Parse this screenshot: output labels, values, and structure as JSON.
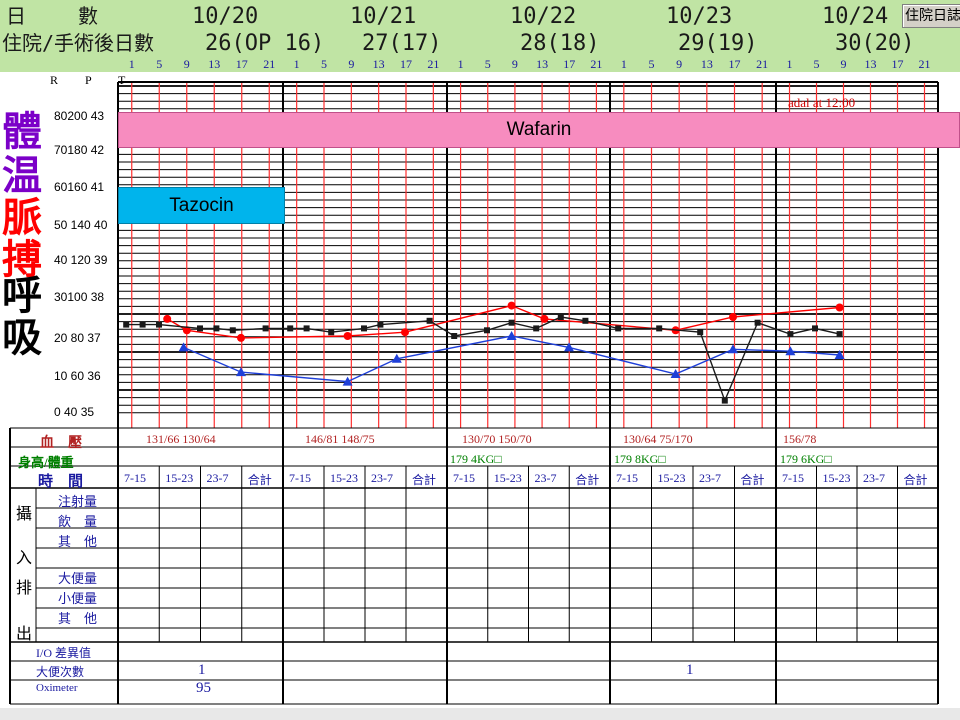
{
  "header": {
    "row1_label": "日　　 數",
    "dates": [
      "10/20",
      "10/21",
      "10/22",
      "10/23",
      "10/24"
    ],
    "row2_label": "住院/手術後日數",
    "postop_days": [
      "26(OP 16)",
      "27(17)",
      "28(18)",
      "29(19)",
      "30(20)"
    ],
    "hours": [
      "1",
      "5",
      "9",
      "13",
      "17",
      "21"
    ],
    "button_label": "住院日誌"
  },
  "chart": {
    "axis_header": "R P T",
    "y_labels": [
      "80200 43",
      "70180 42",
      "60160 41",
      "50 140 40",
      "40 120 39",
      "30100 38",
      "20 80 37",
      "10 60 36",
      "0 40 35"
    ],
    "side_chars": [
      "體",
      "温",
      "脈",
      "搏",
      "呼",
      "吸"
    ],
    "side_colors": [
      "#7b00c8",
      "#7b00c8",
      "#ff0000",
      "#ff0000",
      "#000000",
      "#000000"
    ],
    "partial_note": "adal at 12:00",
    "banners": {
      "wafarin": "Wafarin",
      "tazocin": "Tazocin"
    }
  },
  "chart_data": {
    "type": "line",
    "x_days": [
      "10/20",
      "10/21",
      "10/22",
      "10/23",
      "10/24"
    ],
    "series": [
      {
        "color": "#ff0000",
        "marker": "circle",
        "points": [
          [
            0.3,
            24.5
          ],
          [
            0.42,
            21.5
          ],
          [
            0.75,
            19.5
          ],
          [
            1.4,
            20
          ],
          [
            1.75,
            21
          ],
          [
            2.4,
            28
          ],
          [
            2.6,
            24.5
          ],
          [
            3.4,
            21.5
          ],
          [
            3.75,
            25
          ],
          [
            4.4,
            27.5
          ]
        ]
      },
      {
        "color": "#1a1a1a",
        "marker": "square",
        "points": [
          [
            0.05,
            23
          ],
          [
            0.15,
            23
          ],
          [
            0.25,
            23
          ],
          [
            0.5,
            22
          ],
          [
            0.6,
            22
          ],
          [
            0.7,
            21.5
          ],
          [
            0.9,
            22
          ],
          [
            1.05,
            22
          ],
          [
            1.15,
            22
          ],
          [
            1.3,
            21
          ],
          [
            1.5,
            22
          ],
          [
            1.6,
            23
          ],
          [
            1.9,
            24
          ],
          [
            2.05,
            20
          ],
          [
            2.25,
            21.5
          ],
          [
            2.4,
            23.5
          ],
          [
            2.55,
            22
          ],
          [
            2.7,
            25
          ],
          [
            2.85,
            24
          ],
          [
            3.05,
            22
          ],
          [
            3.3,
            22
          ],
          [
            3.55,
            21
          ],
          [
            3.7,
            3
          ],
          [
            3.9,
            23.5
          ],
          [
            4.1,
            20.5
          ],
          [
            4.25,
            22
          ],
          [
            4.4,
            20.5
          ]
        ]
      },
      {
        "color": "#1e3fd8",
        "marker": "triangle",
        "points": [
          [
            0.4,
            17
          ],
          [
            0.75,
            10.5
          ],
          [
            1.4,
            8
          ],
          [
            1.7,
            14
          ],
          [
            2.4,
            20
          ],
          [
            2.75,
            17
          ],
          [
            3.4,
            10
          ],
          [
            3.75,
            16.5
          ],
          [
            4.1,
            16
          ],
          [
            4.4,
            15
          ]
        ]
      }
    ]
  },
  "table": {
    "rows": {
      "bp": "血　壓",
      "height_weight": "身高/體重",
      "time": "時　間"
    },
    "bp_values": [
      "131/66 130/64",
      "146/81 148/75",
      "130/70 150/70",
      "130/64 75/170",
      "156/78"
    ],
    "height_weight_values": [
      "",
      "",
      "179 4KG□",
      "179 8KG□",
      "179 6KG□"
    ],
    "shifts": [
      "7-15",
      "15-23",
      "23-7",
      "合計"
    ],
    "intake_label": [
      "攝",
      "入"
    ],
    "output_label": [
      "排",
      "出"
    ],
    "intake_items": [
      "注射量",
      "飲　量",
      "其　他"
    ],
    "output_items": [
      "大便量",
      "小便量",
      "其　他"
    ],
    "io_diff": "I/O 差異值",
    "stool_count": "大便次數",
    "oximeter": "Oximeter",
    "stool_values": [
      "1",
      "",
      "",
      "1",
      ""
    ],
    "oximeter_values": [
      "95",
      "",
      "",
      "",
      ""
    ]
  }
}
